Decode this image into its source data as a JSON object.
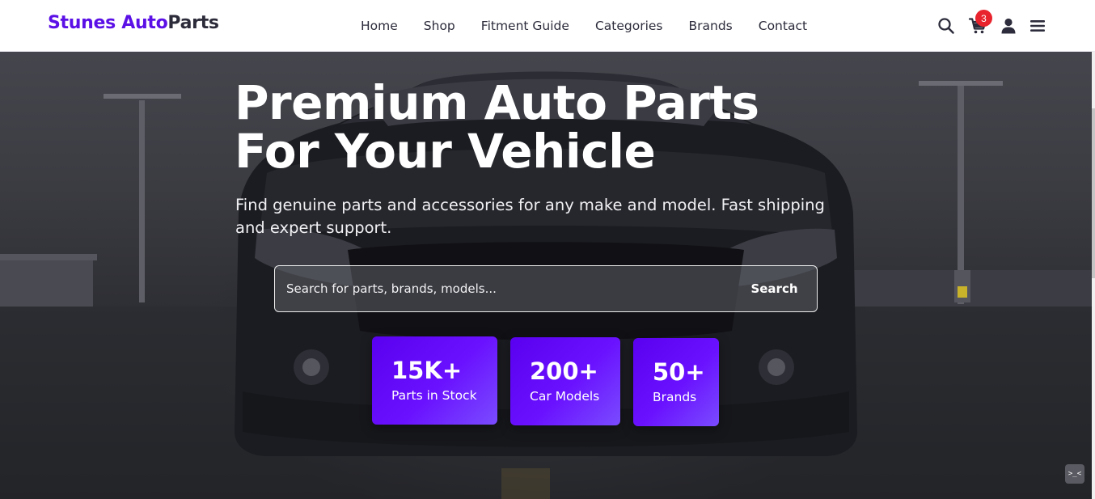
{
  "brand": {
    "part1": "Stunes Auto",
    "part2": "Parts",
    "color_primary": "#5b10e6",
    "color_secondary": "#2b2b3a"
  },
  "nav": {
    "links": [
      {
        "label": "Home"
      },
      {
        "label": "Shop"
      },
      {
        "label": "Fitment Guide"
      },
      {
        "label": "Categories"
      },
      {
        "label": "Brands"
      },
      {
        "label": "Contact"
      }
    ]
  },
  "header_icons": {
    "search": "search-icon",
    "cart": "cart-icon",
    "cart_count": "3",
    "account": "user-icon",
    "menu": "hamburger-menu-icon",
    "badge_color": "#e8232d"
  },
  "hero": {
    "title_line1": "Premium Auto Parts",
    "title_line2": "For Your Vehicle",
    "subtitle": "Find genuine parts and accessories for any make and model. Fast shipping and expert support.",
    "search": {
      "placeholder": "Search for parts, brands, models...",
      "button_label": "Search"
    },
    "stats": [
      {
        "value": "15K+",
        "label": "Parts in Stock"
      },
      {
        "value": "200+",
        "label": "Car Models"
      },
      {
        "value": "50+",
        "label": "Brands"
      }
    ],
    "accent_color": "#5a00f0"
  },
  "dev_badge": {
    "text": ">_<"
  }
}
